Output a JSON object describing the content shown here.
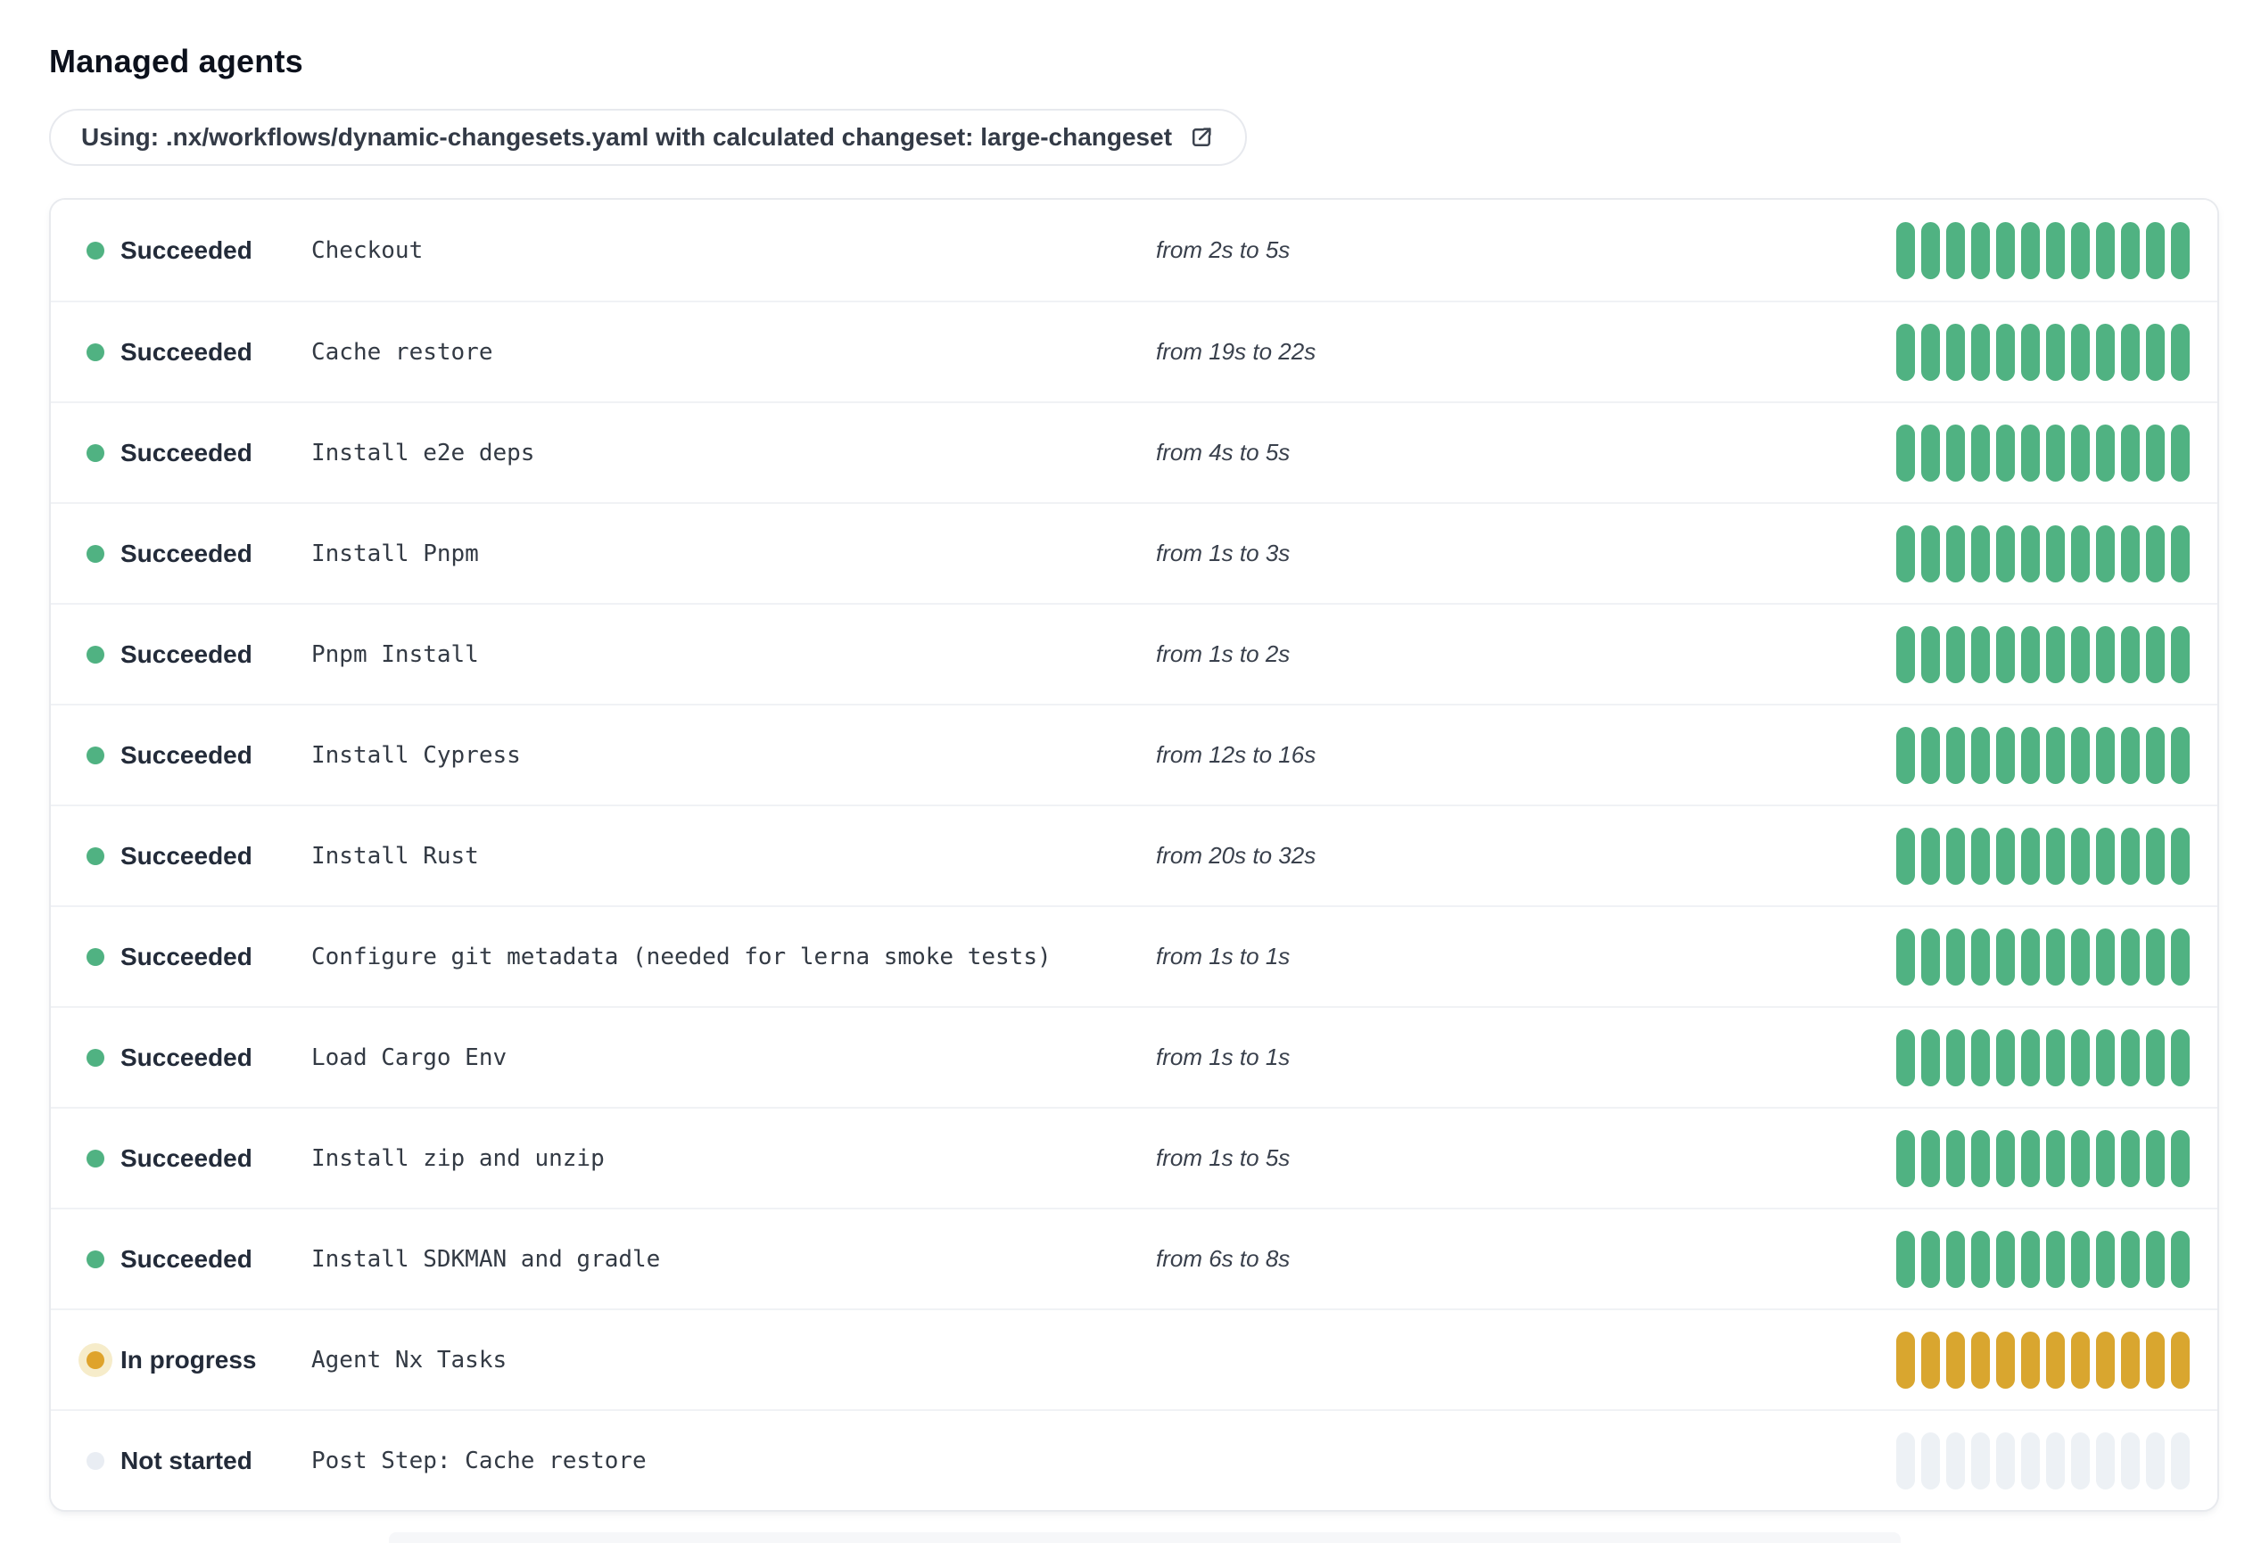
{
  "page": {
    "title": "Managed agents"
  },
  "workflow_banner": {
    "text": "Using: .nx/workflows/dynamic-changesets.yaml with calculated changeset: large-changeset",
    "icon": "external-link-icon"
  },
  "agents": {
    "segments_per_bar": 12,
    "status_colors": {
      "succeeded": "#50b282",
      "in_progress": "#d9a62f",
      "not_started": "#edf1f5"
    },
    "rows": [
      {
        "status": "succeeded",
        "status_label": "Succeeded",
        "name": "Checkout",
        "duration": "from 2s to 5s"
      },
      {
        "status": "succeeded",
        "status_label": "Succeeded",
        "name": "Cache restore",
        "duration": "from 19s to 22s"
      },
      {
        "status": "succeeded",
        "status_label": "Succeeded",
        "name": "Install e2e deps",
        "duration": "from 4s to 5s"
      },
      {
        "status": "succeeded",
        "status_label": "Succeeded",
        "name": "Install Pnpm",
        "duration": "from 1s to 3s"
      },
      {
        "status": "succeeded",
        "status_label": "Succeeded",
        "name": "Pnpm Install",
        "duration": "from 1s to 2s"
      },
      {
        "status": "succeeded",
        "status_label": "Succeeded",
        "name": "Install Cypress",
        "duration": "from 12s to 16s"
      },
      {
        "status": "succeeded",
        "status_label": "Succeeded",
        "name": "Install Rust",
        "duration": "from 20s to 32s"
      },
      {
        "status": "succeeded",
        "status_label": "Succeeded",
        "name": "Configure git metadata (needed for lerna smoke tests)",
        "duration": "from 1s to 1s"
      },
      {
        "status": "succeeded",
        "status_label": "Succeeded",
        "name": "Load Cargo Env",
        "duration": "from 1s to 1s"
      },
      {
        "status": "succeeded",
        "status_label": "Succeeded",
        "name": "Install zip and unzip",
        "duration": "from 1s to 5s"
      },
      {
        "status": "succeeded",
        "status_label": "Succeeded",
        "name": "Install SDKMAN and gradle",
        "duration": "from 6s to 8s"
      },
      {
        "status": "in_progress",
        "status_label": "In progress",
        "name": "Agent Nx Tasks",
        "duration": ""
      },
      {
        "status": "not_started",
        "status_label": "Not started",
        "name": "Post Step: Cache restore",
        "duration": ""
      }
    ]
  }
}
